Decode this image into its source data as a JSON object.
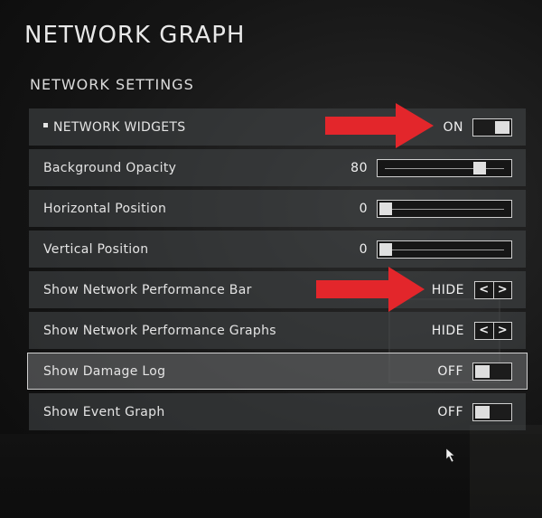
{
  "page_title": "NETWORK GRAPH",
  "section_title": "NETWORK SETTINGS",
  "accent_color": "#e3262b",
  "rows": [
    {
      "label": "NETWORK WIDGETS",
      "value": "ON",
      "control": "toggle",
      "state": "on"
    },
    {
      "label": "Background Opacity",
      "value": "80",
      "control": "slider",
      "level_percent": 80
    },
    {
      "label": "Horizontal Position",
      "value": "0",
      "control": "slider",
      "level_percent": 0
    },
    {
      "label": "Vertical Position",
      "value": "0",
      "control": "slider",
      "level_percent": 0
    },
    {
      "label": "Show Network Performance Bar",
      "value": "HIDE",
      "control": "stepper"
    },
    {
      "label": "Show Network Performance Graphs",
      "value": "HIDE",
      "control": "stepper"
    },
    {
      "label": "Show Damage Log",
      "value": "OFF",
      "control": "toggle",
      "state": "off",
      "selected": true
    },
    {
      "label": "Show Event Graph",
      "value": "OFF",
      "control": "toggle",
      "state": "off"
    }
  ],
  "stepper_icons": {
    "prev": "chevron-left-icon",
    "next": "chevron-right-icon"
  },
  "stepper_glyphs": {
    "prev": "<",
    "next": ">"
  }
}
